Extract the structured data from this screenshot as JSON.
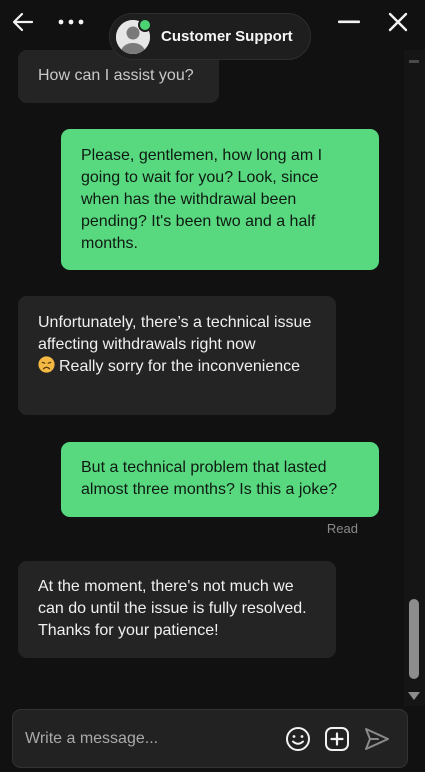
{
  "header": {
    "title": "Customer Support",
    "icons": {
      "back": "arrow-left-icon",
      "more": "more-dots-icon",
      "minimize": "minimize-icon",
      "close": "close-icon"
    }
  },
  "messages": [
    {
      "sender": "agent",
      "text": "How can I assist you?"
    },
    {
      "sender": "user",
      "text": "Please, gentlemen, how long am I going to wait for you? Look, since when has the withdrawal been pending? It's been two and a half months."
    },
    {
      "sender": "agent",
      "text_before_emoji": "Unfortunately, there’s a technical issue affecting withdrawals right now",
      "emoji": "disappointed-face-emoji",
      "text_after_emoji": "Really sorry for the inconvenience"
    },
    {
      "sender": "user",
      "text": "But a technical problem that lasted almost three months? Is this a joke?",
      "status": "Read"
    },
    {
      "sender": "agent",
      "text": "At the moment, there's not much we can do until the issue is fully resolved. Thanks for your patience!"
    }
  ],
  "composer": {
    "placeholder": "Write a message...",
    "value": ""
  },
  "colors": {
    "background": "#111111",
    "agent_bubble": "#242424",
    "user_bubble": "#58d97f",
    "online_status": "#4cd474"
  },
  "scroll": {
    "position_fraction": 0.9
  }
}
